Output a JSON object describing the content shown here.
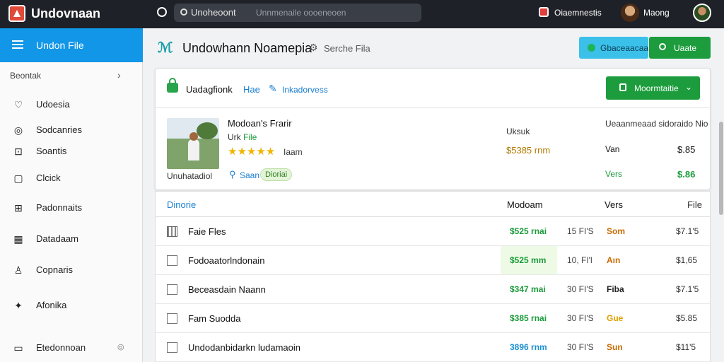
{
  "topbar": {
    "app_title": "Undovnaan",
    "search_value": "Unoheoont",
    "search_placeholder": "Unnmenaile oooeneoen",
    "user1_text": "Oiaemnestis",
    "user2_text": "Maong"
  },
  "sidebar": {
    "header_label": "Undon File",
    "section_label": "Beontak",
    "items": [
      {
        "label": "Udoesia",
        "icon": "heart-icon",
        "extra": ""
      },
      {
        "label": "Sodcanries",
        "icon": "circle-icon",
        "extra": ""
      },
      {
        "label": "Soantis",
        "icon": "layout-icon",
        "extra": ""
      },
      {
        "label": "Clcick",
        "icon": "square-icon",
        "extra": ""
      },
      {
        "label": "Padonnaits",
        "icon": "grid-icon",
        "extra": ""
      },
      {
        "label": "Datadaam",
        "icon": "table-icon",
        "extra": ""
      },
      {
        "label": "Copnaris",
        "icon": "person-icon",
        "extra": ""
      },
      {
        "label": "Afonika",
        "icon": "star-icon",
        "extra": ""
      },
      {
        "label": "Etedonnoan",
        "icon": "image-icon",
        "extra": "◎"
      }
    ]
  },
  "main": {
    "title": "Undowhann Noamepia",
    "subtitle": "Serche Fila",
    "button_cyan": "Gbaceaacaa",
    "button_green": "Uaate"
  },
  "card": {
    "title": "Uadagfionk",
    "link": "Hae",
    "link2": "Inkadorvess",
    "dropdown_label": "Moormtaitie",
    "product_name": "Modoan's Frarir",
    "product_sub1": "Urk",
    "product_sub2": "File",
    "stars": "★★★★★",
    "stars_label": "Iaam",
    "caption": "Unuhatadiol",
    "save_text": "Saan",
    "badge": "Dioriai",
    "mid_label": "Uksuk",
    "mid_price": "$5385 rnm",
    "right_header": "Ueaanmeaad sidoraido Nio",
    "row1_label": "Van",
    "row1_value": "$.85",
    "row2_label": "Vers",
    "row2_value": "$.86"
  },
  "table": {
    "headers": [
      "Dinorie",
      "Modoam",
      "Vers",
      "File"
    ],
    "rows": [
      {
        "name": "Faie Fles",
        "price": "$525 rnai",
        "price_color": "#1c9c3c",
        "mid": "15 FI'S",
        "vers": "Som",
        "vers_color": "#c96a00",
        "file": "$7.1'5",
        "highlight": false,
        "grid_box": true
      },
      {
        "name": "Fodoaatorlndonain",
        "price": "$525 mm",
        "price_color": "#1c9c3c",
        "mid": "10, FI'l",
        "vers": "Aın",
        "vers_color": "#c96a00",
        "file": "$1,65",
        "highlight": true,
        "grid_box": false
      },
      {
        "name": "Beceasdain Naann",
        "price": "$347 mai",
        "price_color": "#1c9c3c",
        "mid": "30 FI'S",
        "vers": "Fiba",
        "vers_color": "#222",
        "file": "$7.1'5",
        "highlight": false,
        "grid_box": false
      },
      {
        "name": "Fam Suodda",
        "price": "$385 rnai",
        "price_color": "#1c9c3c",
        "mid": "30 FI'S",
        "vers": "Gue",
        "vers_color": "#e0a000",
        "file": "$5.85",
        "highlight": false,
        "grid_box": false
      },
      {
        "name": "Undodanbidarkn ludamaoin",
        "price": "3896 rnm",
        "price_color": "#1a8fd0",
        "mid": "30 FI'S",
        "vers": "Sun",
        "vers_color": "#c96a00",
        "file": "$11'5",
        "highlight": false,
        "grid_box": false
      }
    ]
  }
}
